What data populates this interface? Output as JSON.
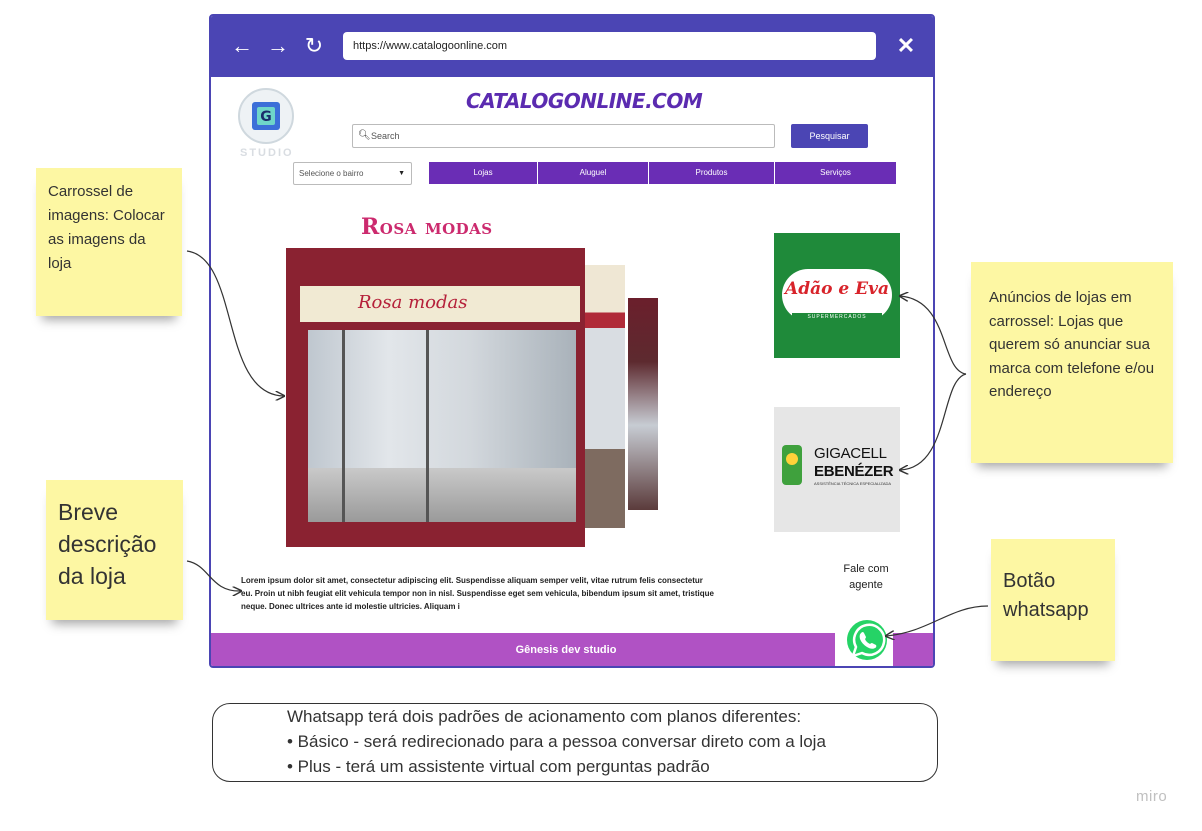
{
  "browser": {
    "url": "https://www.catalogoonline.com",
    "nav_icons": [
      "arrow-left-icon",
      "arrow-right-icon",
      "refresh-icon",
      "close-icon"
    ]
  },
  "site": {
    "title": "CATALOGONLINE.COM",
    "logo_text": "STUDIO",
    "search_placeholder": "Search",
    "search_button": "Pesquisar",
    "neighborhood_select": "Selecione o bairro",
    "tabs": [
      "Lojas",
      "Aluguel",
      "Produtos",
      "Serviços"
    ],
    "store_name": "Rosa modas",
    "store_sign": "Rosa  modas",
    "description": "Lorem ipsum dolor sit amet, consectetur adipiscing elit. Suspendisse aliquam semper velit, vitae rutrum felis consectetur eu. Proin ut nibh feugiat elit vehicula tempor non in nisl. Suspendisse eget sem vehicula, bibendum ipsum sit amet, tristique neque. Donec ultrices ante id molestie ultricies. Aliquam i",
    "ads": [
      {
        "name": "Adão e Eva",
        "subtitle": "SUPERMERCADOS",
        "color": "#1f8a3a"
      },
      {
        "name_line1": "GIGACELL",
        "name_line2": "EBENÉZER",
        "subtitle": "ASSISTÊNCIA TÉCNICA ESPECIALIZADA"
      }
    ],
    "whatsapp_label": "Fale com agente",
    "footer": "Gênesis dev studio"
  },
  "stickies": {
    "carousel": "Carrossel de imagens: Colocar as imagens  da loja",
    "description": "Breve descrição da loja",
    "ads": "Anúncios de lojas em carrossel: Lojas que querem só anunciar sua marca com telefone e/ou endereço",
    "whatsapp": "Botão whatsapp"
  },
  "note": {
    "line1": "Whatsapp terá dois padrões de acionamento com planos diferentes:",
    "line2": "• Básico - será redirecionado para a pessoa conversar direto com a loja",
    "line3": "• Plus - terá um assistente virtual com perguntas padrão"
  },
  "watermark": "miro",
  "colors": {
    "browser_bar": "#4b45b4",
    "nav_tabs": "#6a2db5",
    "footer": "#b052c4",
    "sticky": "#fdf7a3",
    "whatsapp": "#25d366"
  }
}
